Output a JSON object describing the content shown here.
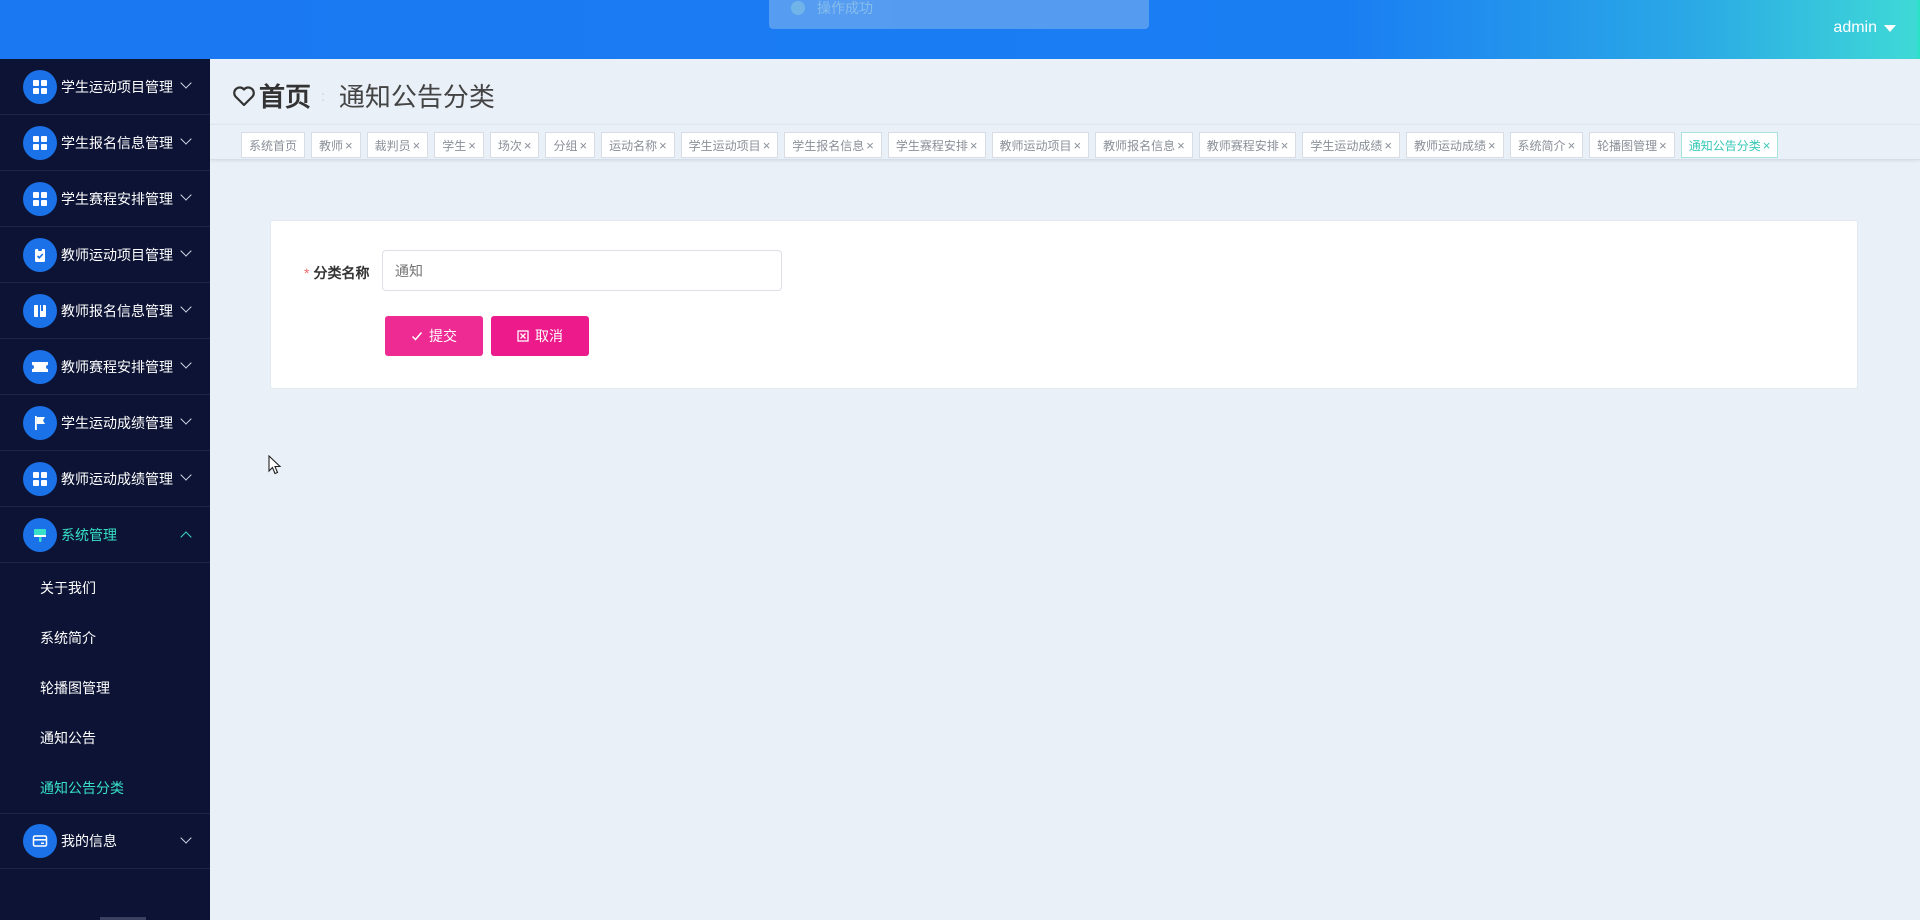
{
  "header": {
    "toast": "操作成功",
    "user": "admin"
  },
  "sidebar": {
    "items": [
      {
        "label": "学生运动项目管理",
        "icon": "grid-icon"
      },
      {
        "label": "学生报名信息管理",
        "icon": "grid-icon"
      },
      {
        "label": "学生赛程安排管理",
        "icon": "grid-icon"
      },
      {
        "label": "教师运动项目管理",
        "icon": "clipboard-icon"
      },
      {
        "label": "教师报名信息管理",
        "icon": "book-icon"
      },
      {
        "label": "教师赛程安排管理",
        "icon": "ticket-icon"
      },
      {
        "label": "学生运动成绩管理",
        "icon": "flag-icon"
      },
      {
        "label": "教师运动成绩管理",
        "icon": "grid-icon"
      },
      {
        "label": "系统管理",
        "icon": "brush-icon"
      }
    ],
    "system_children": [
      "关于我们",
      "系统简介",
      "轮播图管理",
      "通知公告",
      "通知公告分类"
    ],
    "last_item": {
      "label": "我的信息",
      "icon": "card-icon"
    }
  },
  "breadcrumb": {
    "home": "首页",
    "separator": ":",
    "current": "通知公告分类"
  },
  "tags": [
    "系统首页",
    "教师",
    "裁判员",
    "学生",
    "场次",
    "分组",
    "运动名称",
    "学生运动项目",
    "学生报名信息",
    "学生赛程安排",
    "教师运动项目",
    "教师报名信息",
    "教师赛程安排",
    "学生运动成绩",
    "教师运动成绩",
    "系统简介",
    "轮播图管理",
    "通知公告分类"
  ],
  "form": {
    "required_mark": "*",
    "label": "分类名称",
    "value": "",
    "placeholder": "通知",
    "submit": "提交",
    "cancel": "取消"
  },
  "colors": {
    "header_blue": "#1a78f2",
    "accent_teal": "#37e0c8",
    "sidebar_bg": "#0c1334",
    "button_pink": "#ec1a8a"
  }
}
